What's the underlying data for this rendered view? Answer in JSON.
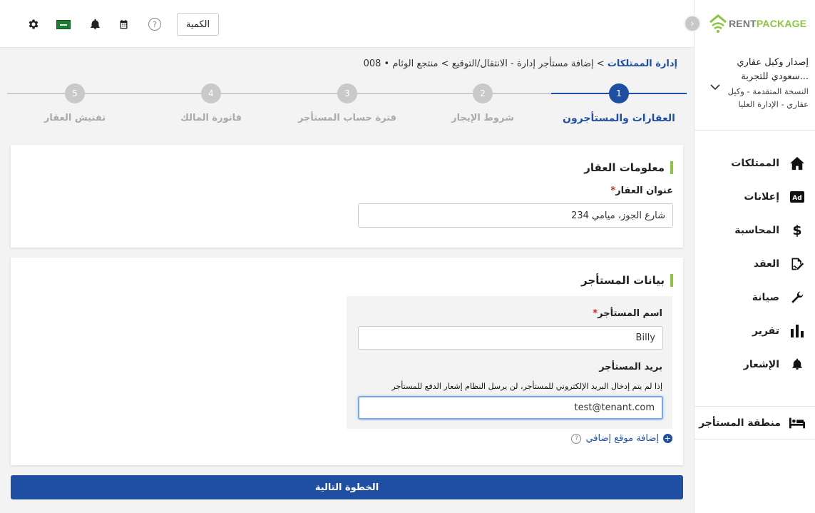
{
  "topbar": {
    "quantity_label": "الكمية",
    "help_symbol": "?"
  },
  "brand": {
    "logo_rent": "RENT",
    "logo_package": "PACKAGE",
    "accent_color": "#8cc63f",
    "primary_color": "#1f4fa3"
  },
  "account": {
    "name": "إصدار وكيل عقاري سعودي للتجربة...",
    "role": "النسخة المتقدمة - وكيل عقاري - الإدارة العليا"
  },
  "nav": {
    "items": [
      {
        "label": "الممتلكات",
        "icon": "home-icon"
      },
      {
        "label": "إعلانات",
        "icon": "ad-icon"
      },
      {
        "label": "المحاسبة",
        "icon": "dollar-icon"
      },
      {
        "label": "العقد",
        "icon": "contract-sign-icon"
      },
      {
        "label": "صيانة",
        "icon": "wrench-icon"
      },
      {
        "label": "تقرير",
        "icon": "bar-chart-icon"
      },
      {
        "label": "الإشعار",
        "icon": "bell-icon"
      }
    ],
    "tenant_zone": "منطقة المستأجر"
  },
  "breadcrumb": {
    "root": "إدارة الممتلكات",
    "separator": ">",
    "middle": "إضافة مستأجر إدارة - الانتقال/التوقيع",
    "current": "منتجع الوئام • 008"
  },
  "stepper": {
    "steps": [
      {
        "number": "1",
        "label": "العقارات والمستأجرون"
      },
      {
        "number": "2",
        "label": "شروط الإيجار"
      },
      {
        "number": "3",
        "label": "فترة حساب المستأجر"
      },
      {
        "number": "4",
        "label": "فاتورة المالك"
      },
      {
        "number": "5",
        "label": "تفتيش العقار"
      }
    ]
  },
  "property": {
    "section_title": "معلومات العقار",
    "address_label": "عنوان العقار",
    "required_mark": "*",
    "address_value": "234 شارع الجوز، ميامي"
  },
  "tenant": {
    "section_title": "بيانات المستأجر",
    "name_label": "اسم المستأجر",
    "required_mark": "*",
    "name_value": "Billy",
    "email_label": "بريد المستأجر",
    "email_hint": "إذا لم يتم إدخال البريد الإلكتروني للمستأجر، لن يرسل النظام إشعار الدفع للمستأجر",
    "email_value": "test@tenant.com",
    "add_location": "إضافة موقع إضافي",
    "plus_symbol": "+",
    "help_symbol": "?"
  },
  "actions": {
    "next_step": "الخطوة التالية"
  }
}
